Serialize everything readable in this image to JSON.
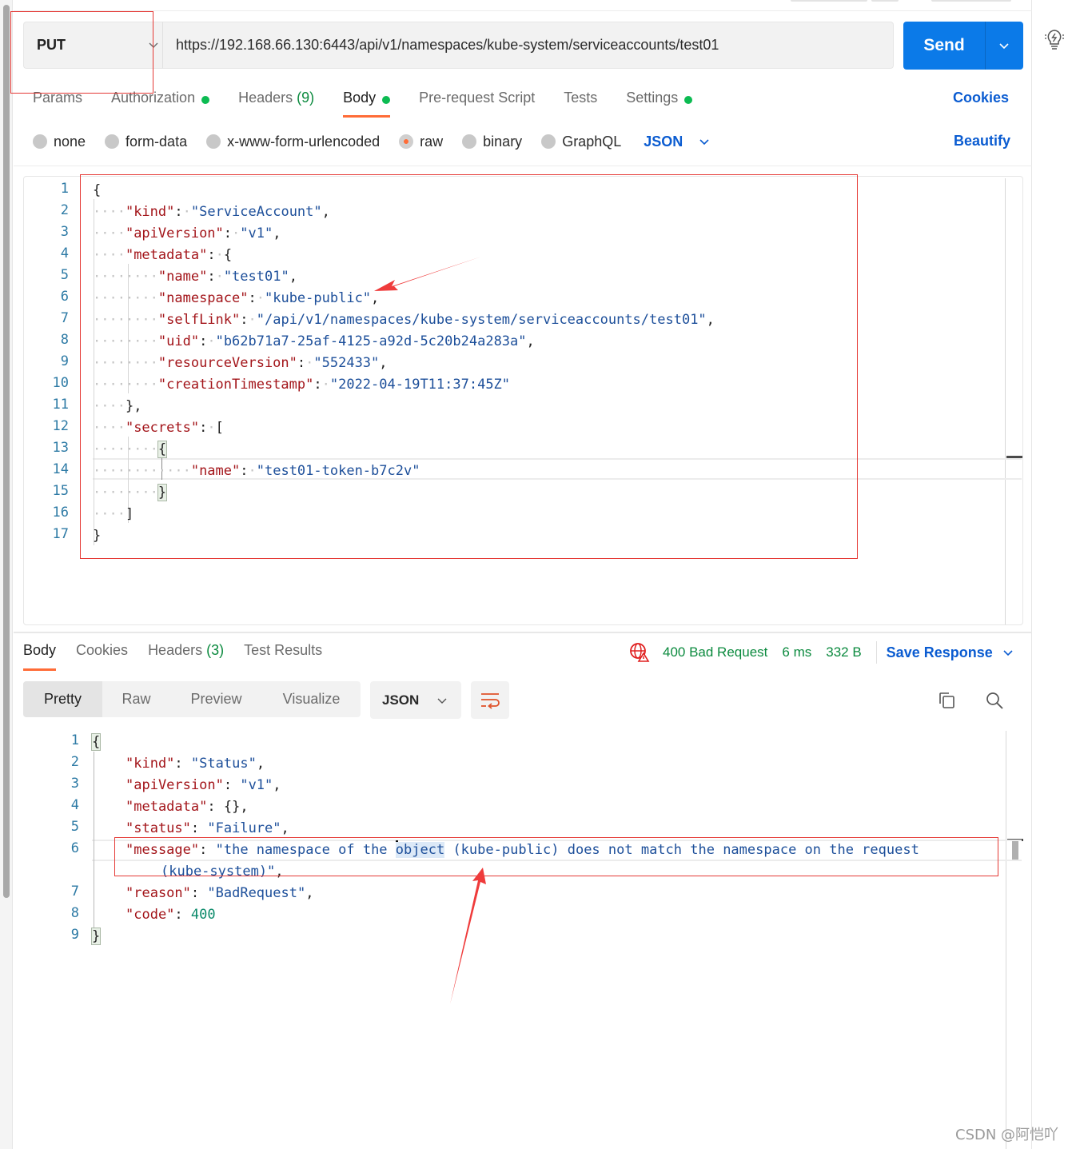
{
  "request": {
    "method": "PUT",
    "url": "https://192.168.66.130:6443/api/v1/namespaces/kube-system/serviceaccounts/test01",
    "send_label": "Send",
    "tabs": [
      {
        "label": "Params",
        "dot": false,
        "count": null,
        "active": false
      },
      {
        "label": "Authorization",
        "dot": true,
        "count": null,
        "active": false
      },
      {
        "label": "Headers",
        "dot": false,
        "count": "(9)",
        "active": false
      },
      {
        "label": "Body",
        "dot": true,
        "count": null,
        "active": true
      },
      {
        "label": "Pre-request Script",
        "dot": false,
        "count": null,
        "active": false
      },
      {
        "label": "Tests",
        "dot": false,
        "count": null,
        "active": false
      },
      {
        "label": "Settings",
        "dot": true,
        "count": null,
        "active": false
      }
    ],
    "cookies_label": "Cookies",
    "body_types": [
      {
        "label": "none",
        "selected": false
      },
      {
        "label": "form-data",
        "selected": false
      },
      {
        "label": "x-www-form-urlencoded",
        "selected": false
      },
      {
        "label": "raw",
        "selected": true
      },
      {
        "label": "binary",
        "selected": false
      },
      {
        "label": "GraphQL",
        "selected": false
      }
    ],
    "raw_format": "JSON",
    "beautify_label": "Beautify",
    "body_lines": [
      {
        "num": "1",
        "text": "{"
      },
      {
        "num": "2",
        "text": "\"kind\": \"ServiceAccount\","
      },
      {
        "num": "3",
        "text": "\"apiVersion\": \"v1\","
      },
      {
        "num": "4",
        "text": "\"metadata\": {"
      },
      {
        "num": "5",
        "text": "\"name\": \"test01\","
      },
      {
        "num": "6",
        "text": "\"namespace\": \"kube-public\","
      },
      {
        "num": "7",
        "text": "\"selfLink\": \"/api/v1/namespaces/kube-system/serviceaccounts/test01\","
      },
      {
        "num": "8",
        "text": "\"uid\": \"b62b71a7-25af-4125-a92d-5c20b24a283a\","
      },
      {
        "num": "9",
        "text": "\"resourceVersion\": \"552433\","
      },
      {
        "num": "10",
        "text": "\"creationTimestamp\": \"2022-04-19T11:37:45Z\""
      },
      {
        "num": "11",
        "text": "},"
      },
      {
        "num": "12",
        "text": "\"secrets\": ["
      },
      {
        "num": "13",
        "text": "{"
      },
      {
        "num": "14",
        "text": "\"name\": \"test01-token-b7c2v\""
      },
      {
        "num": "15",
        "text": "}"
      },
      {
        "num": "16",
        "text": "]"
      },
      {
        "num": "17",
        "text": "}"
      }
    ]
  },
  "response": {
    "tabs": [
      {
        "label": "Body",
        "count": null,
        "active": true
      },
      {
        "label": "Cookies",
        "count": null,
        "active": false
      },
      {
        "label": "Headers",
        "count": "(3)",
        "active": false
      },
      {
        "label": "Test Results",
        "count": null,
        "active": false
      }
    ],
    "status": "400 Bad Request",
    "time": "6 ms",
    "size": "332 B",
    "save_label": "Save Response",
    "view_modes": [
      "Pretty",
      "Raw",
      "Preview",
      "Visualize"
    ],
    "active_view": "Pretty",
    "format": "JSON",
    "body_lines": [
      {
        "num": "1",
        "text": "{"
      },
      {
        "num": "2",
        "text": "\"kind\": \"Status\","
      },
      {
        "num": "3",
        "text": "\"apiVersion\": \"v1\","
      },
      {
        "num": "4",
        "text": "\"metadata\": {},"
      },
      {
        "num": "5",
        "text": "\"status\": \"Failure\","
      },
      {
        "num": "6",
        "text": "\"message\": \"the namespace of the object (kube-public) does not match the namespace on the request (kube-system)\","
      },
      {
        "num": "7",
        "text": "\"reason\": \"BadRequest\","
      },
      {
        "num": "8",
        "text": "\"code\": 400"
      },
      {
        "num": "9",
        "text": "}"
      }
    ],
    "message_line1": "\"the namespace of the ",
    "message_selected": "object",
    "message_line1_rest": " (kube-public) does not match the namespace on the request",
    "message_line2": "(kube-system)\","
  },
  "icons": {
    "method_dropdown": "chevron-down-icon",
    "send_dropdown": "chevron-down-icon",
    "status_globe": "globe-warning-icon",
    "wrap": "wrap-lines-icon",
    "copy": "copy-icon",
    "search": "search-icon",
    "right_rail": "lightbulb-icon"
  },
  "colors": {
    "accent_orange": "#ff6c37",
    "send_blue": "#0b7ae8",
    "link_blue": "#0b5cd1",
    "status_green": "#0b8a3e",
    "annotation_red": "#e53935"
  },
  "watermark": "CSDN @阿恺吖"
}
